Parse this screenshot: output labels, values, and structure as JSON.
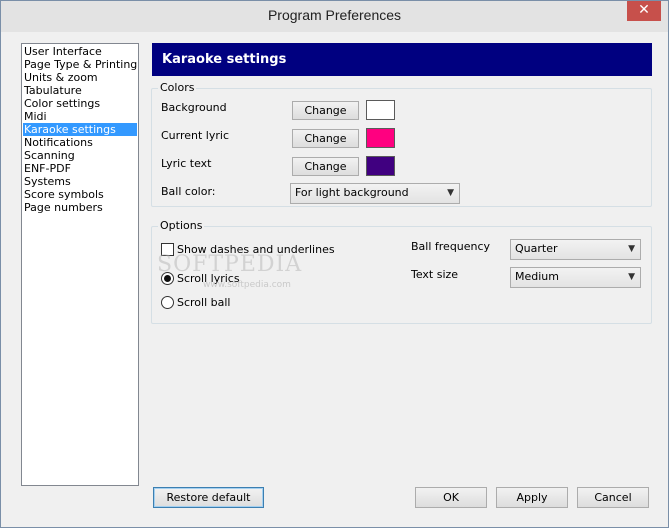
{
  "window": {
    "title": "Program Preferences",
    "close_glyph": "✕"
  },
  "nav": {
    "items": [
      {
        "label": "User Interface"
      },
      {
        "label": "Page Type & Printing"
      },
      {
        "label": "Units & zoom"
      },
      {
        "label": "Tabulature"
      },
      {
        "label": "Color settings"
      },
      {
        "label": "Midi"
      },
      {
        "label": "Karaoke settings",
        "selected": true
      },
      {
        "label": "Notifications"
      },
      {
        "label": "Scanning"
      },
      {
        "label": "ENF-PDF"
      },
      {
        "label": "Systems"
      },
      {
        "label": "Score symbols"
      },
      {
        "label": "Page numbers"
      }
    ]
  },
  "panel": {
    "title": "Karaoke settings"
  },
  "colors": {
    "caption": "Colors",
    "background_label": "Background",
    "background_color": "#ffffff",
    "current_lyric_label": "Current lyric",
    "current_lyric_color": "#ff0080",
    "lyric_text_label": "Lyric text",
    "lyric_text_color": "#400080",
    "change_label": "Change",
    "ball_color_label": "Ball color:",
    "ball_color_value": "For light background"
  },
  "options": {
    "caption": "Options",
    "show_dashes_label": "Show dashes and underlines",
    "show_dashes_checked": false,
    "scroll_lyrics_label": "Scroll lyrics",
    "scroll_ball_label": "Scroll ball",
    "scroll_mode": "Scroll lyrics",
    "ball_frequency_label": "Ball frequency",
    "ball_frequency_value": "Quarter",
    "text_size_label": "Text size",
    "text_size_value": "Medium"
  },
  "footer": {
    "restore_label": "Restore default",
    "ok_label": "OK",
    "apply_label": "Apply",
    "cancel_label": "Cancel"
  },
  "watermark": {
    "text": "SOFTPEDIA",
    "sub": "www.softpedia.com"
  }
}
